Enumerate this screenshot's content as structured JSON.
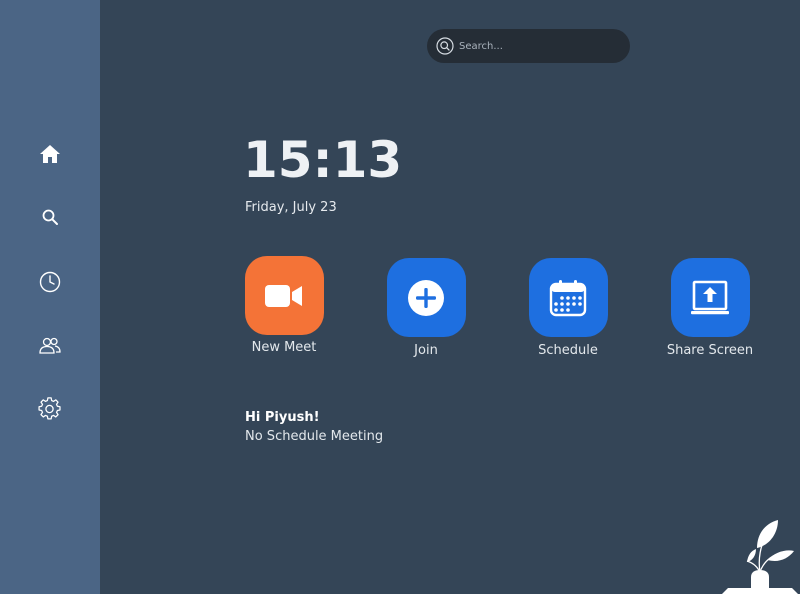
{
  "sidebar": {
    "items": [
      {
        "icon": "home-icon"
      },
      {
        "icon": "search-icon"
      },
      {
        "icon": "clock-icon"
      },
      {
        "icon": "contacts-icon"
      },
      {
        "icon": "gear-icon"
      }
    ]
  },
  "search": {
    "placeholder": "Search..."
  },
  "clock": {
    "time": "15:13",
    "date": "Friday, July 23"
  },
  "actions": [
    {
      "label": "New Meet",
      "icon": "video-camera-icon",
      "color": "#f47337"
    },
    {
      "label": "Join",
      "icon": "plus-circle-icon",
      "color": "#1e6fe0"
    },
    {
      "label": "Schedule",
      "icon": "calendar-icon",
      "color": "#1e6fe0"
    },
    {
      "label": "Share Screen",
      "icon": "share-screen-icon",
      "color": "#1e6fe0"
    }
  ],
  "greeting": {
    "title": "Hi Piyush!",
    "subtitle": "No Schedule Meeting"
  },
  "colors": {
    "background": "#344557",
    "sidebar": "#4b6585",
    "search_bg": "#252d36",
    "accent_orange": "#f47337",
    "accent_blue": "#1e6fe0"
  }
}
